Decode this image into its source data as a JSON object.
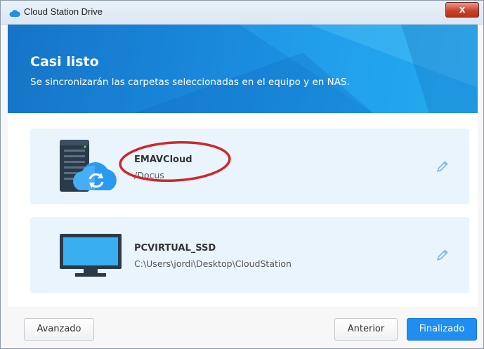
{
  "window": {
    "title": "Cloud Station Drive",
    "close_symbol": "x"
  },
  "banner": {
    "title": "Casi listo",
    "subtitle": "Se sincronizarán las carpetas seleccionadas en el equipo y en NAS."
  },
  "nas_card": {
    "name": "EMAVCloud",
    "path": "/Docus",
    "icon": "nas-sync-icon",
    "edit_icon": "pencil-icon"
  },
  "pc_card": {
    "name": "PCVIRTUAL_SSD",
    "path": "C:\\Users\\jordi\\Desktop\\CloudStation",
    "icon": "monitor-icon",
    "edit_icon": "pencil-icon"
  },
  "footer": {
    "advanced_label": "Avanzado",
    "previous_label": "Anterior",
    "finish_label": "Finalizado"
  },
  "colors": {
    "accent": "#1f8ef0",
    "banner": "#1a8ee0",
    "card_bg": "#eaf4fd",
    "annotation": "#d0262b"
  }
}
